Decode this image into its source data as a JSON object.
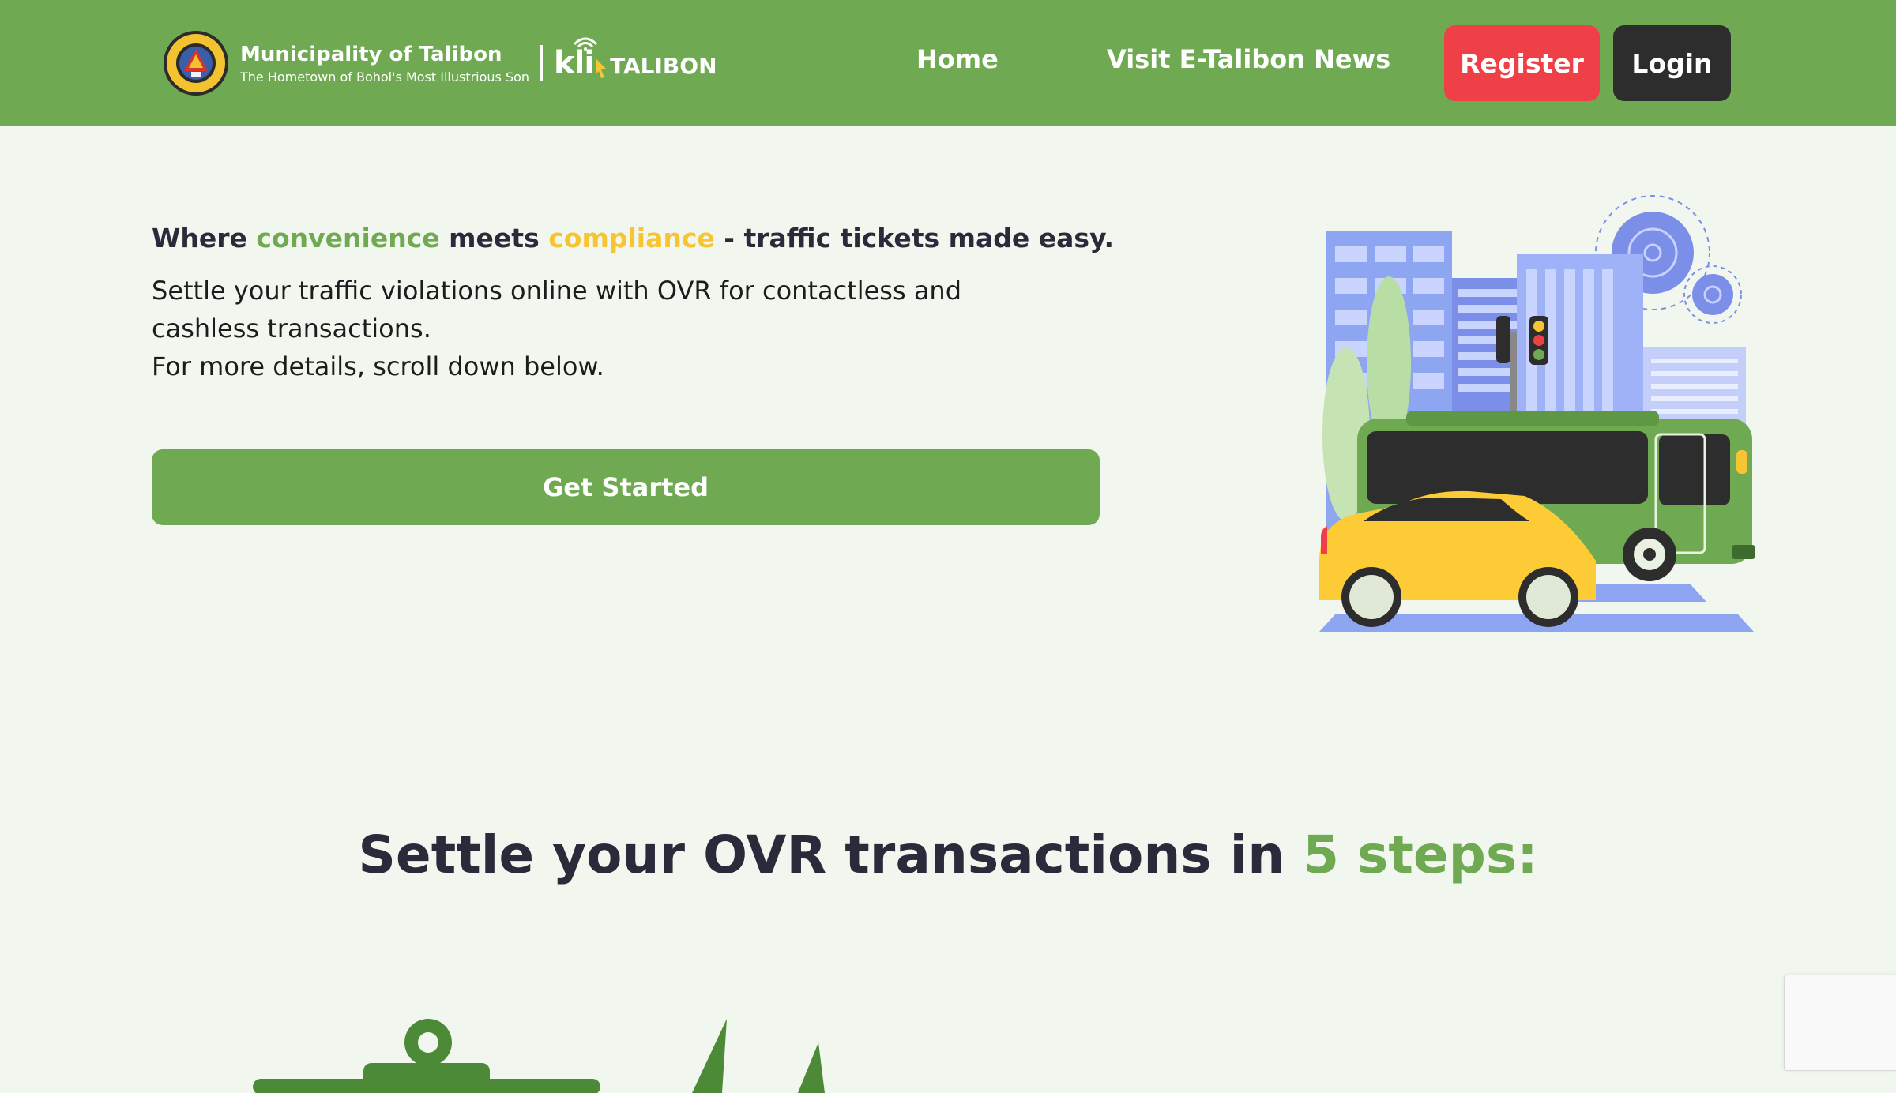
{
  "header": {
    "brand_title": "Municipality of Talibon",
    "brand_subtitle": "The Hometown of Bohol's Most Illustrious Son",
    "klik_word": "kli",
    "klik_talibon": "TALIBON",
    "nav": {
      "home": "Home",
      "news": "Visit E-Talibon News"
    },
    "register_label": "Register",
    "login_label": "Login"
  },
  "hero": {
    "tagline": {
      "part1": "Where ",
      "highlight1": "convenience",
      "part2": " meets ",
      "highlight2": "compliance",
      "part3": " - traffic tickets made easy."
    },
    "description_line1": "Settle your traffic violations online with OVR for contactless and cashless transactions.",
    "description_line2": "For more details, scroll down below.",
    "cta_label": "Get Started"
  },
  "steps": {
    "heading_prefix": "Settle your OVR transactions in ",
    "heading_highlight": "5 steps:"
  },
  "colors": {
    "brand_green": "#6faa53",
    "accent_yellow": "#f7c531",
    "register_red": "#ef3f47",
    "login_dark": "#2d2d2d",
    "background": "#f1f7ee"
  }
}
